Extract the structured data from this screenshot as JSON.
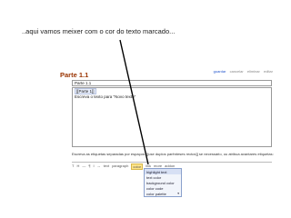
{
  "caption": "..aqui vamos meixer com o cor do texto marcado...",
  "page": {
    "title": "Parte 1.1",
    "actions": {
      "save": "guardar",
      "cancel": "cancelar",
      "delete": "eliminar",
      "edit": "editar"
    }
  },
  "editor": {
    "title_value": "Parte 1.1",
    "body_line_1": "[[Parte 1]]",
    "body_line_2": "Escreva o texto para \"Novo texto\""
  },
  "tags": {
    "hint": "Escreva as etiquetas separadas por espaços. [[use duplos parênteses rectos]] se necessário, ou atribua avantares etiquetas:"
  },
  "toolbar": {
    "buttons": [
      "T",
      "H",
      "—",
      "¶",
      "I",
      "↔",
      "text",
      "paragraph",
      "color",
      "link",
      "more",
      "addon"
    ]
  },
  "color_menu": {
    "items": [
      "highlight text",
      "text color",
      "background color",
      "color code",
      "color palette"
    ],
    "selected_index": 0
  }
}
